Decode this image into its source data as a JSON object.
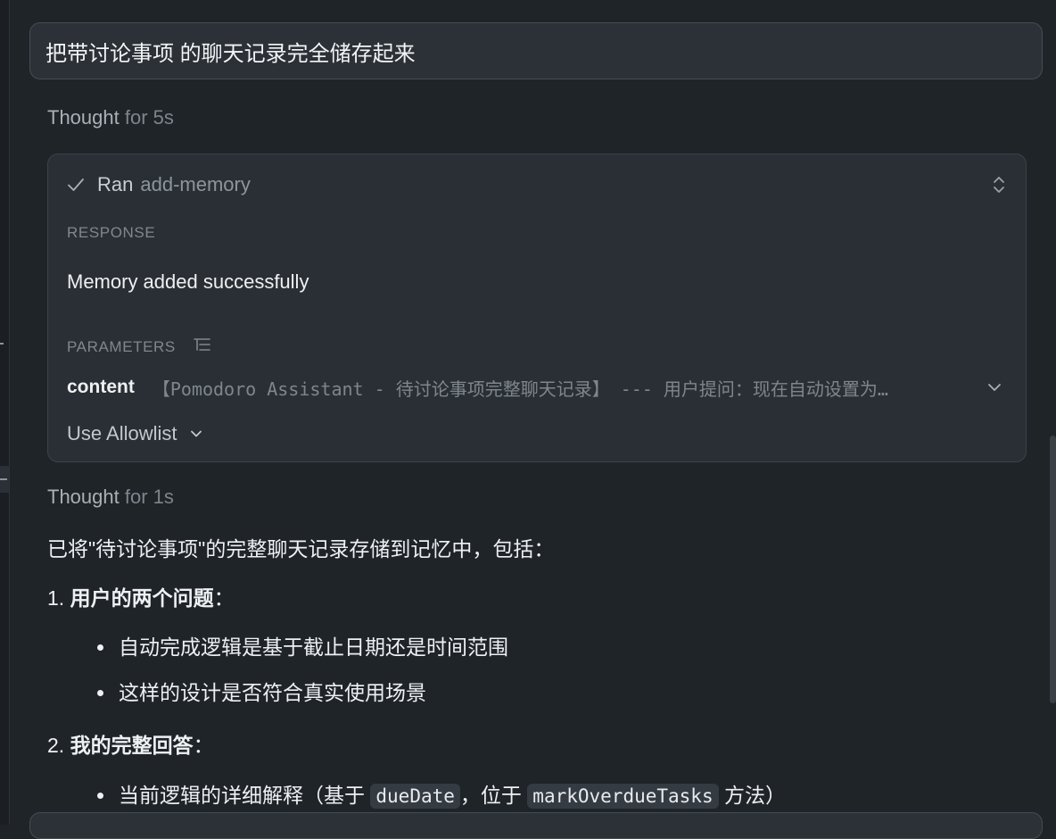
{
  "user_message": "把带讨论事项 的聊天记录完全储存起来",
  "thought1": {
    "lead": "Thought",
    "duration": "for 5s"
  },
  "tool_call": {
    "status": "Ran",
    "tool": "add-memory",
    "response_label": "RESPONSE",
    "response_text": "Memory added successfully",
    "parameters_label": "PARAMETERS",
    "param_key": "content",
    "param_value": "【Pomodoro Assistant - 待讨论事项完整聊天记录】 --- 用户提问：现在自动设置为…",
    "allowlist_label": "Use Allowlist"
  },
  "thought2": {
    "lead": "Thought",
    "duration": "for 1s"
  },
  "answer": {
    "intro": "已将\"待讨论事项\"的完整聊天记录存储到记忆中，包括：",
    "item1_num": "1.",
    "item1_title": "用户的两个问题",
    "item1_colon": "：",
    "item1_bullets": [
      "自动完成逻辑是基于截止日期还是时间范围",
      "这样的设计是否符合真实使用场景"
    ],
    "item2_num": "2.",
    "item2_title": "我的完整回答",
    "item2_colon": "：",
    "item2_bullet_pre": "当前逻辑的详细解释（基于",
    "item2_code1": "dueDate",
    "item2_mid": "，位于",
    "item2_code2": "markOverdueTasks",
    "item2_post": "方法）"
  },
  "icons": {
    "check": "check-icon",
    "expand": "expand-collapse-icon",
    "params": "list-icon",
    "chevron": "chevron-down-icon"
  },
  "colors": {
    "background": "#1f2429",
    "card": "#2a2f35",
    "muted_text": "#7f878e"
  }
}
